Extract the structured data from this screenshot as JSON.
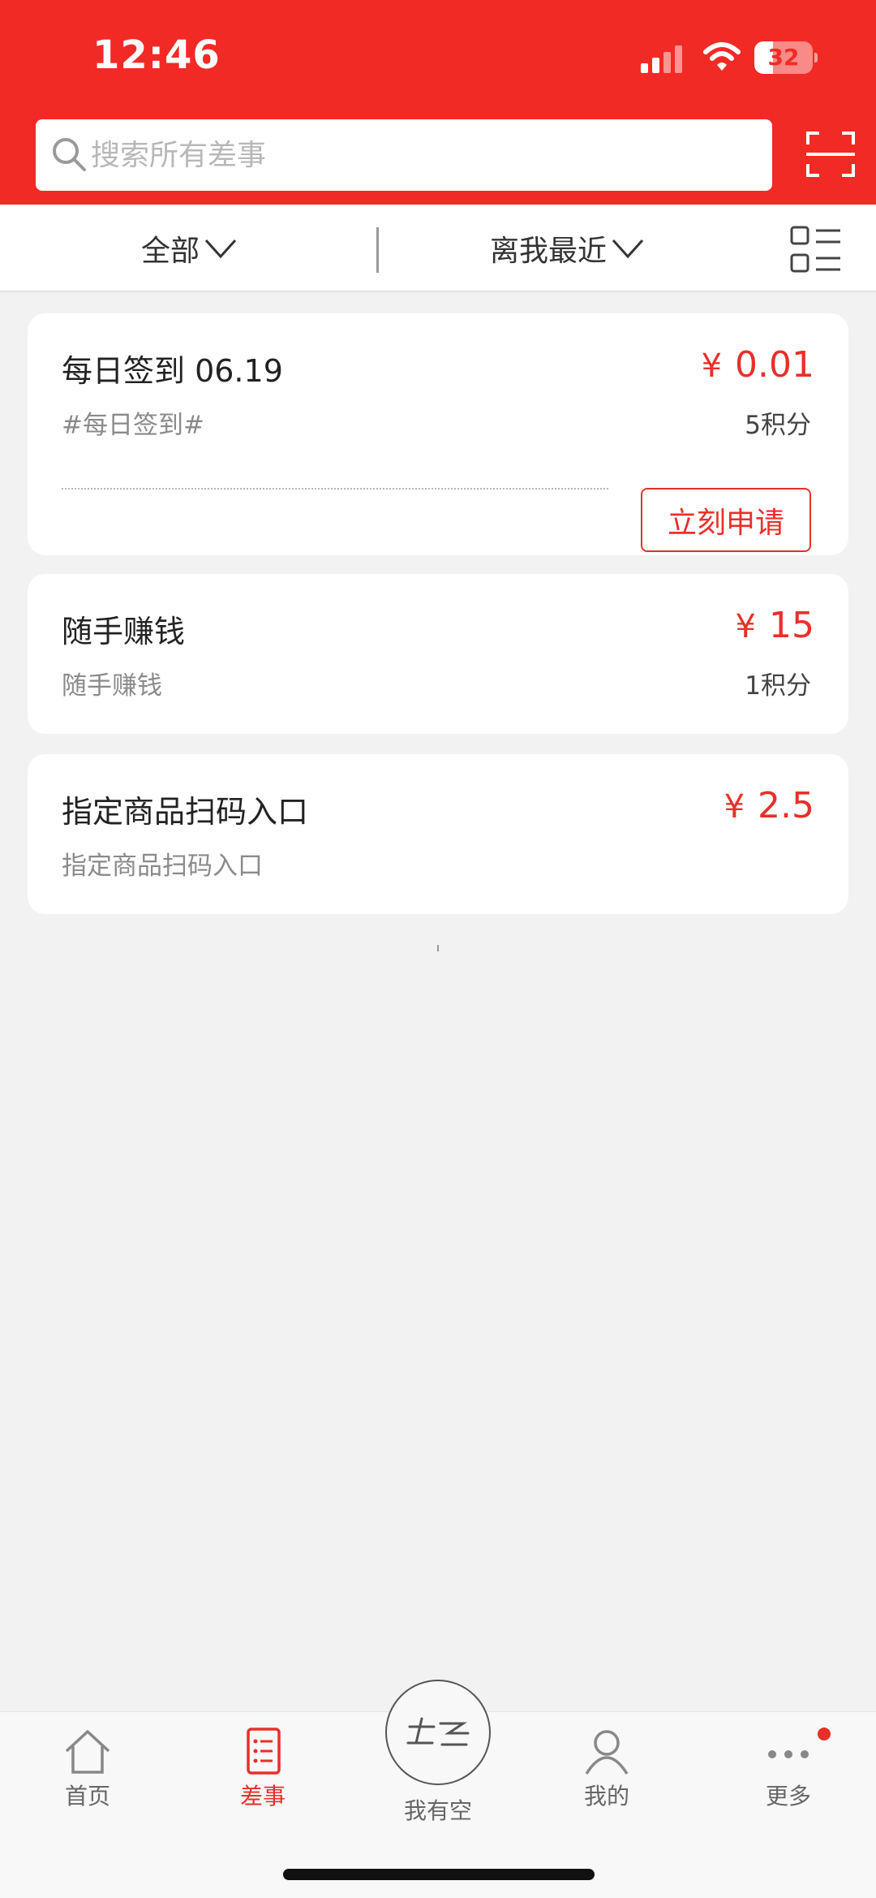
{
  "status_bar": {
    "time": "12:46",
    "battery": "32",
    "battery_level": 0.32
  },
  "search": {
    "placeholder": "搜索所有差事",
    "value": ""
  },
  "filters": {
    "category": "全部",
    "sort": "离我最近"
  },
  "tasks": [
    {
      "title": "每日签到 06.19",
      "subtitle": "#每日签到#",
      "currency": "¥",
      "price": "0.01",
      "points": "5积分",
      "action": "立刻申请"
    },
    {
      "title": "随手赚钱",
      "subtitle": "随手赚钱",
      "currency": "¥",
      "price": "15",
      "points": "1积分"
    },
    {
      "title": "指定商品扫码入口",
      "subtitle": "指定商品扫码入口",
      "currency": "¥",
      "price": "2.5"
    }
  ],
  "tabbar": {
    "home": "首页",
    "tasks": "差事",
    "free": "我有空",
    "me": "我的",
    "more": "更多"
  },
  "colors": {
    "brand_red": "#f22a25",
    "accent_red": "#e8302a",
    "background": "#f2f2f2"
  },
  "icons": {
    "search": "search-icon",
    "scan": "scan-icon",
    "list_view": "list-view-icon",
    "home": "home-icon",
    "tasks": "task-list-icon",
    "free": "free-logo-icon",
    "me": "person-icon",
    "more": "more-dots-icon"
  }
}
